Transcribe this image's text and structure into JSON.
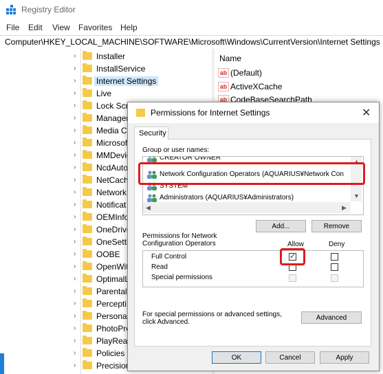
{
  "app": {
    "title": "Registry Editor",
    "accent_color": "#1e7fd8"
  },
  "menu": [
    "File",
    "Edit",
    "View",
    "Favorites",
    "Help"
  ],
  "address": "Computer\\HKEY_LOCAL_MACHINE\\SOFTWARE\\Microsoft\\Windows\\CurrentVersion\\Internet Settings",
  "tree": {
    "items": [
      {
        "label": "Installer"
      },
      {
        "label": "InstallService"
      },
      {
        "label": "Internet Settings",
        "selected": true
      },
      {
        "label": "Live"
      },
      {
        "label": "Lock Scre"
      },
      {
        "label": "Manager"
      },
      {
        "label": "Media Ce"
      },
      {
        "label": "Microsof"
      },
      {
        "label": "MMDevic"
      },
      {
        "label": "NcdAuto"
      },
      {
        "label": "NetCach"
      },
      {
        "label": "Network"
      },
      {
        "label": "Notificat"
      },
      {
        "label": "OEMInfo"
      },
      {
        "label": "OneDrive"
      },
      {
        "label": "OneSetti"
      },
      {
        "label": "OOBE"
      },
      {
        "label": "OpenWit"
      },
      {
        "label": "OptimalL"
      },
      {
        "label": "Parental"
      },
      {
        "label": "Percepti"
      },
      {
        "label": "Personali"
      },
      {
        "label": "PhotoPro"
      },
      {
        "label": "PlayRead"
      },
      {
        "label": "Policies"
      },
      {
        "label": "Precision"
      }
    ]
  },
  "values": {
    "column_name": "Name",
    "rows": [
      {
        "label": "(Default)"
      },
      {
        "label": "ActiveXCache"
      },
      {
        "label": "CodeBaseSearchPath"
      }
    ]
  },
  "dialog": {
    "title": "Permissions for Internet Settings",
    "close_glyph": "✕",
    "tab": "Security",
    "group_label": "Group or user names:",
    "groups": [
      {
        "label": "CREATOR OWNER"
      },
      {
        "label": "Network Configuration Operators (AQUARIUS¥Network Con",
        "selected": true
      },
      {
        "label": "SYSTEM"
      },
      {
        "label": "Administrators (AQUARIUS¥Administrators)"
      }
    ],
    "add_button": "Add...",
    "remove_button": "Remove",
    "perm_label": "Permissions for Network Configuration Operators",
    "allow_header": "Allow",
    "deny_header": "Deny",
    "permissions": [
      {
        "label": "Full Control",
        "allow": true,
        "deny": false,
        "disabled": false
      },
      {
        "label": "Read",
        "allow": false,
        "deny": false,
        "disabled": false
      },
      {
        "label": "Special permissions",
        "allow": false,
        "deny": false,
        "disabled": true
      }
    ],
    "special_text": "For special permissions or advanced settings, click Advanced.",
    "advanced_button": "Advanced",
    "ok_button": "OK",
    "cancel_button": "Cancel",
    "apply_button": "Apply"
  },
  "highlight_color": "#e0191c"
}
